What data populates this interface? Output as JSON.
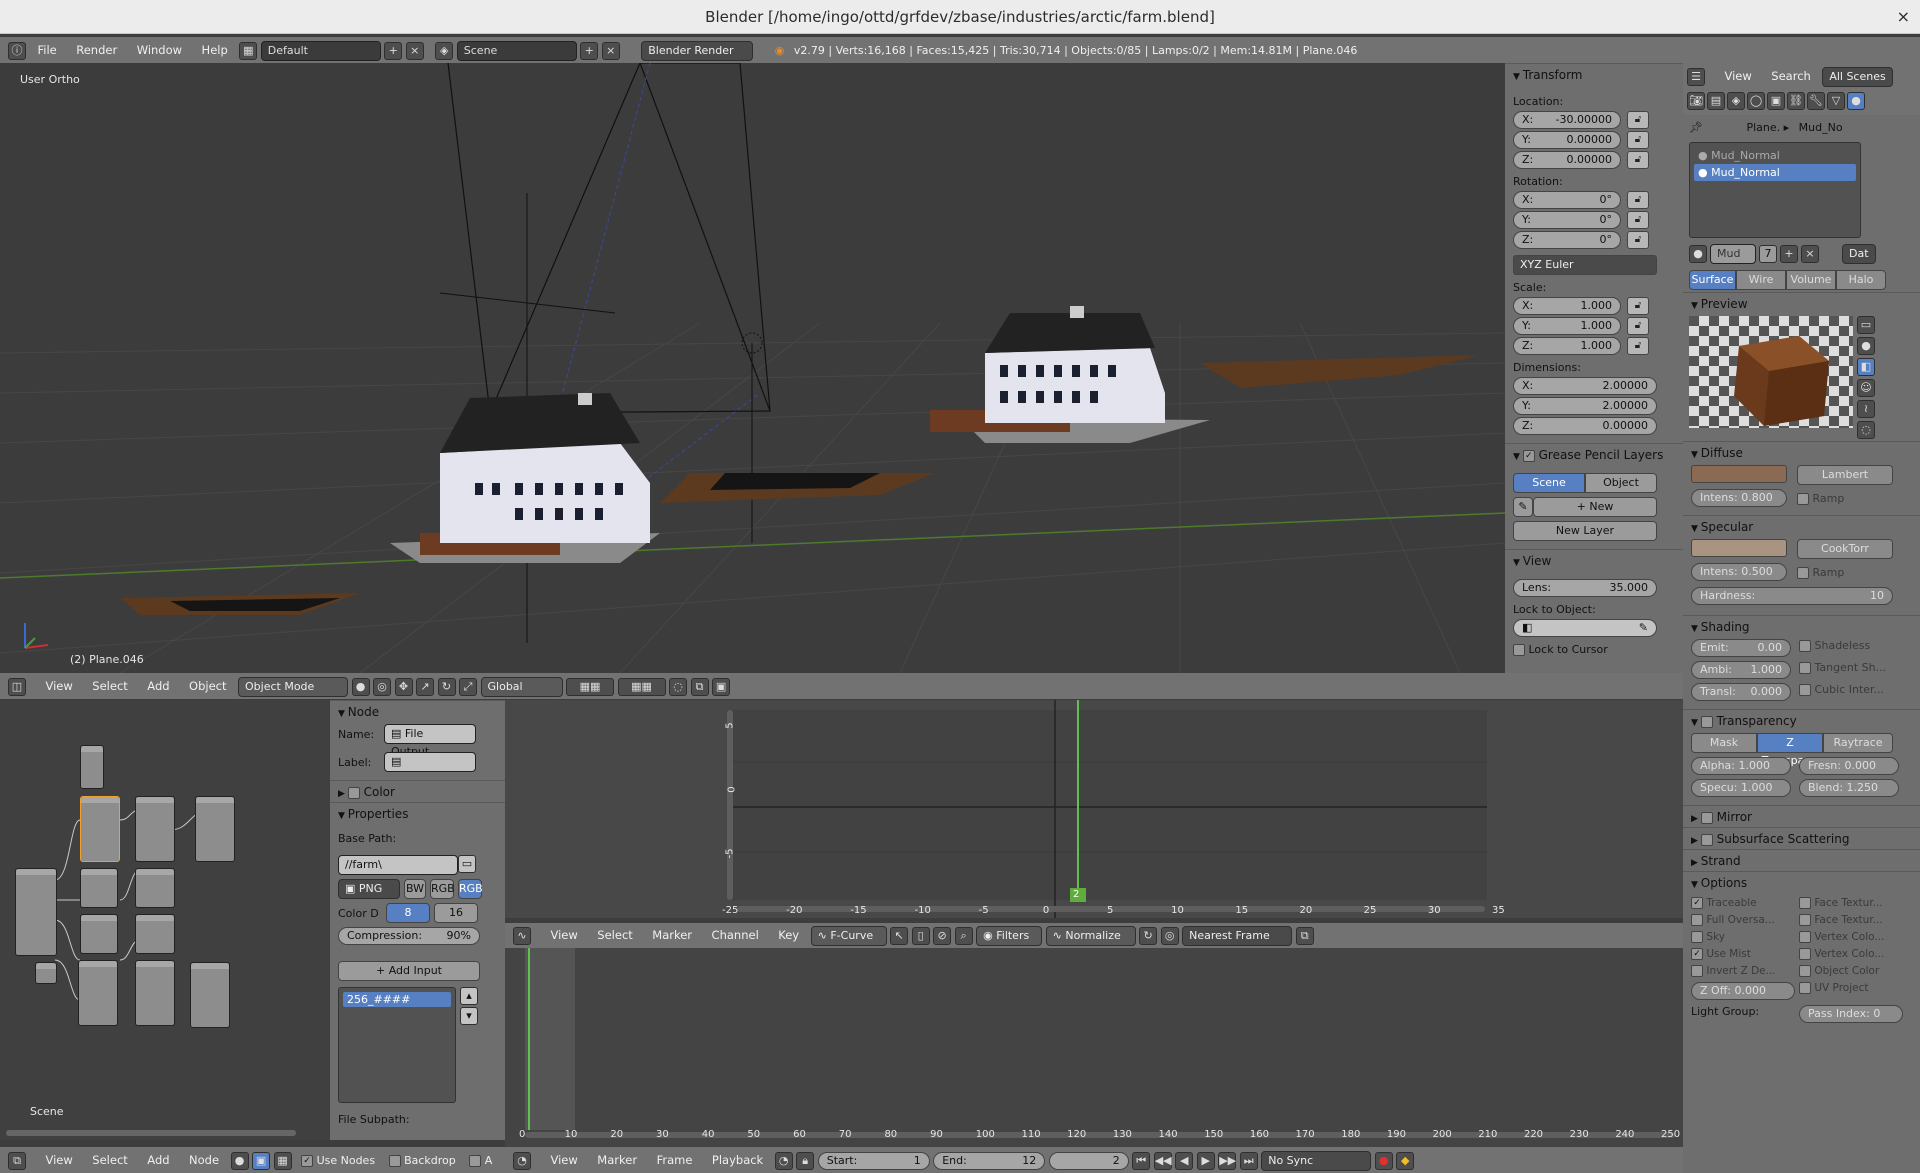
{
  "window": {
    "title": "Blender [/home/ingo/ottd/grfdev/zbase/industries/arctic/farm.blend]",
    "close": "×"
  },
  "top_menu": {
    "items": [
      "File",
      "Render",
      "Window",
      "Help"
    ],
    "layout": "Default",
    "scene": "Scene",
    "engine": "Blender Render",
    "stats": "v2.79 | Verts:16,168 | Faces:15,425 | Tris:30,714 | Objects:0/85 | Lamps:0/2 | Mem:14.81M | Plane.046"
  },
  "viewport": {
    "view_label": "User Ortho",
    "object_label": "(2) Plane.046",
    "header": {
      "menus": [
        "View",
        "Select",
        "Add",
        "Object"
      ],
      "mode": "Object Mode",
      "orientation": "Global"
    }
  },
  "transform_panel": {
    "title": "Transform",
    "location_label": "Location:",
    "location": [
      {
        "axis": "X:",
        "value": "-30.00000"
      },
      {
        "axis": "Y:",
        "value": "0.00000"
      },
      {
        "axis": "Z:",
        "value": "0.00000"
      }
    ],
    "rotation_label": "Rotation:",
    "rotation": [
      {
        "axis": "X:",
        "value": "0°"
      },
      {
        "axis": "Y:",
        "value": "0°"
      },
      {
        "axis": "Z:",
        "value": "0°"
      }
    ],
    "rotation_mode": "XYZ Euler",
    "scale_label": "Scale:",
    "scale": [
      {
        "axis": "X:",
        "value": "1.000"
      },
      {
        "axis": "Y:",
        "value": "1.000"
      },
      {
        "axis": "Z:",
        "value": "1.000"
      }
    ],
    "dimensions_label": "Dimensions:",
    "dimensions": [
      {
        "axis": "X:",
        "value": "2.00000"
      },
      {
        "axis": "Y:",
        "value": "2.00000"
      },
      {
        "axis": "Z:",
        "value": "0.00000"
      }
    ],
    "grease_title": "Grease Pencil Layers",
    "grease_scene": "Scene",
    "grease_object": "Object",
    "grease_new": "New",
    "grease_new_layer": "New Layer",
    "view_title": "View",
    "lens_label": "Lens:",
    "lens_value": "35.000",
    "lock_label": "Lock to Object:",
    "lock_cursor": "Lock to Cursor"
  },
  "properties": {
    "header_menus": [
      "View",
      "Search",
      "All Scenes"
    ],
    "breadcrumb": [
      "Plane.",
      "Mud_No"
    ],
    "materials": [
      "Mud_Normal",
      "Mud_Normal"
    ],
    "mat_name": "Mud",
    "mat_users": "7",
    "mat_data": "Dat",
    "tabs": [
      "Surface",
      "Wire",
      "Volume",
      "Halo"
    ],
    "preview_title": "Preview",
    "diffuse_title": "Diffuse",
    "diffuse_shader": "Lambert",
    "diffuse_intens": "Intens: 0.800",
    "ramp": "Ramp",
    "specular_title": "Specular",
    "specular_shader": "CookTorr",
    "specular_intens": "Intens: 0.500",
    "hardness": "Hardness:",
    "hardness_value": "10",
    "shading_title": "Shading",
    "emit": "Emit:",
    "emit_value": "0.00",
    "ambi": "Ambi:",
    "ambi_value": "1.000",
    "transl": "Transl:",
    "transl_value": "0.000",
    "shadeless": "Shadeless",
    "tangent": "Tangent Sh...",
    "cubic": "Cubic Inter...",
    "transparency_title": "Transparency",
    "trans_modes": [
      "Mask",
      "Z Transpar...",
      "Raytrace"
    ],
    "alpha": "Alpha: 1.000",
    "fresnel": "Fresn: 0.000",
    "specu": "Specu: 1.000",
    "blend": "Blend: 1.250",
    "mirror_title": "Mirror",
    "sss_title": "Subsurface Scattering",
    "strand_title": "Strand",
    "options_title": "Options",
    "options_left": [
      "Traceable",
      "Full Oversa...",
      "Sky",
      "Use Mist",
      "Invert Z De..."
    ],
    "options_right": [
      "Face Textur...",
      "Face Textur...",
      "Vertex Colo...",
      "Vertex Colo...",
      "Object Color",
      "UV Project"
    ],
    "zoff": "Z Off: 0.000",
    "pass_index": "Pass Index: 0",
    "light_group": "Light Group:"
  },
  "node_editor": {
    "scene_label": "Scene",
    "header_menus": [
      "View",
      "Select",
      "Add",
      "Node"
    ],
    "use_nodes": "Use Nodes",
    "backdrop": "Backdrop",
    "auto": "A"
  },
  "node_panel": {
    "title": "Node",
    "name_label": "Name:",
    "name_value": "File Output...",
    "label_label": "Label:",
    "color_title": "Color",
    "properties_title": "Properties",
    "base_path_label": "Base Path:",
    "base_path": "//farm\\",
    "format": "PNG",
    "bw": "BW",
    "rgb": "RGB",
    "rgba": "RGB",
    "color_depth": "Color D",
    "depth_8": "8",
    "depth_16": "16",
    "compression": "Compression:",
    "compression_value": "90%",
    "add_input": "Add Input",
    "input_item": "256_####",
    "file_subpath": "File Subpath:"
  },
  "graph_editor": {
    "y_ticks": [
      "5",
      "0",
      "-5"
    ],
    "x_ticks": [
      "-25",
      "-20",
      "-15",
      "-10",
      "-5",
      "0",
      "5",
      "10",
      "15",
      "20",
      "25",
      "30",
      "35"
    ],
    "frame": "2",
    "header_menus": [
      "View",
      "Select",
      "Marker",
      "Channel",
      "Key"
    ],
    "mode": "F-Curve",
    "filters": "Filters",
    "normalize": "Normalize",
    "snap": "Nearest Frame"
  },
  "timeline": {
    "ticks": [
      "0",
      "10",
      "20",
      "30",
      "40",
      "50",
      "60",
      "70",
      "80",
      "90",
      "100",
      "110",
      "120",
      "130",
      "140",
      "150",
      "160",
      "170",
      "180",
      "190",
      "200",
      "210",
      "220",
      "230",
      "240",
      "250"
    ],
    "header_menus": [
      "View",
      "Marker",
      "Frame",
      "Playback"
    ],
    "start_label": "Start:",
    "start": "1",
    "end_label": "End:",
    "end": "12",
    "current": "2",
    "sync": "No Sync"
  }
}
